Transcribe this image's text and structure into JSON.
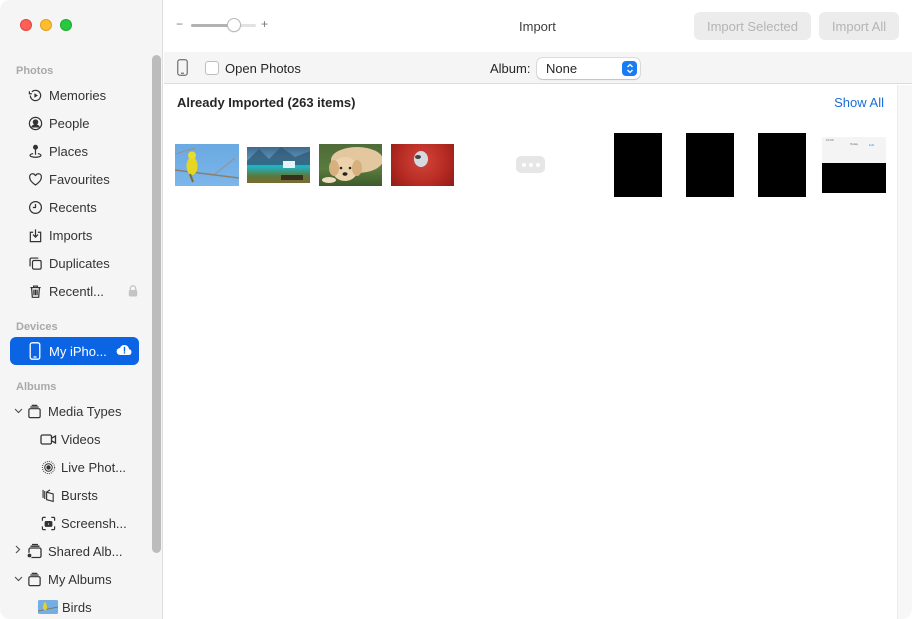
{
  "window": {
    "title": "Import",
    "traffic_lights": [
      "close",
      "minimize",
      "maximize"
    ]
  },
  "toolbar": {
    "zoom_minus": "−",
    "zoom_plus": "+",
    "zoom_level_fraction": 0.66,
    "import_selected_label": "Import Selected",
    "import_all_label": "Import All"
  },
  "sidebar": {
    "sections": [
      {
        "label": "Photos",
        "items": [
          {
            "label": "Memories",
            "icon": "memories-icon"
          },
          {
            "label": "People",
            "icon": "people-icon"
          },
          {
            "label": "Places",
            "icon": "places-icon"
          },
          {
            "label": "Favourites",
            "icon": "heart-icon"
          },
          {
            "label": "Recents",
            "icon": "clock-icon"
          },
          {
            "label": "Imports",
            "icon": "import-icon"
          },
          {
            "label": "Duplicates",
            "icon": "duplicates-icon"
          },
          {
            "label": "Recentl...",
            "icon": "trash-icon",
            "locked": true
          }
        ]
      },
      {
        "label": "Devices",
        "items": [
          {
            "label": "My iPho...",
            "icon": "iphone-icon",
            "selected": true,
            "badge": "icloud-alert-icon"
          }
        ]
      },
      {
        "label": "Albums",
        "items": [
          {
            "label": "Media Types",
            "icon": "album-stack-icon",
            "expanded": true
          },
          {
            "label": "Videos",
            "icon": "video-icon",
            "indent": 1
          },
          {
            "label": "Live Phot...",
            "icon": "live-photo-icon",
            "indent": 1
          },
          {
            "label": "Bursts",
            "icon": "bursts-icon",
            "indent": 1
          },
          {
            "label": "Screensh...",
            "icon": "screenshot-icon",
            "indent": 1
          },
          {
            "label": "Shared Alb...",
            "icon": "shared-album-icon",
            "expanded": false
          },
          {
            "label": "My Albums",
            "icon": "album-stack-icon",
            "expanded": true
          },
          {
            "label": "Birds",
            "icon": "album-thumbnail",
            "indent": 1
          }
        ]
      }
    ]
  },
  "options_bar": {
    "open_photos_label": "Open Photos",
    "open_photos_checked": false,
    "album_label": "Album:",
    "album_value": "None"
  },
  "content": {
    "section_title": "Already Imported (263 items)",
    "show_all_label": "Show All",
    "thumbnails": [
      {
        "subject": "yellow bird on branch"
      },
      {
        "subject": "mountain lake"
      },
      {
        "subject": "puppy on grass"
      },
      {
        "subject": "seal in red flowers"
      },
      {
        "subject": "more-items"
      },
      {
        "subject": "black image"
      },
      {
        "subject": "black image"
      },
      {
        "subject": "black image"
      },
      {
        "subject": "screenshot"
      }
    ],
    "screenshot_thumb": {
      "time": "10:00",
      "title": "Today",
      "edit": "Edit"
    }
  },
  "colors": {
    "accent": "#0a64e4",
    "link": "#1a6ed8",
    "sidebar_bg": "#f5f5f5"
  }
}
